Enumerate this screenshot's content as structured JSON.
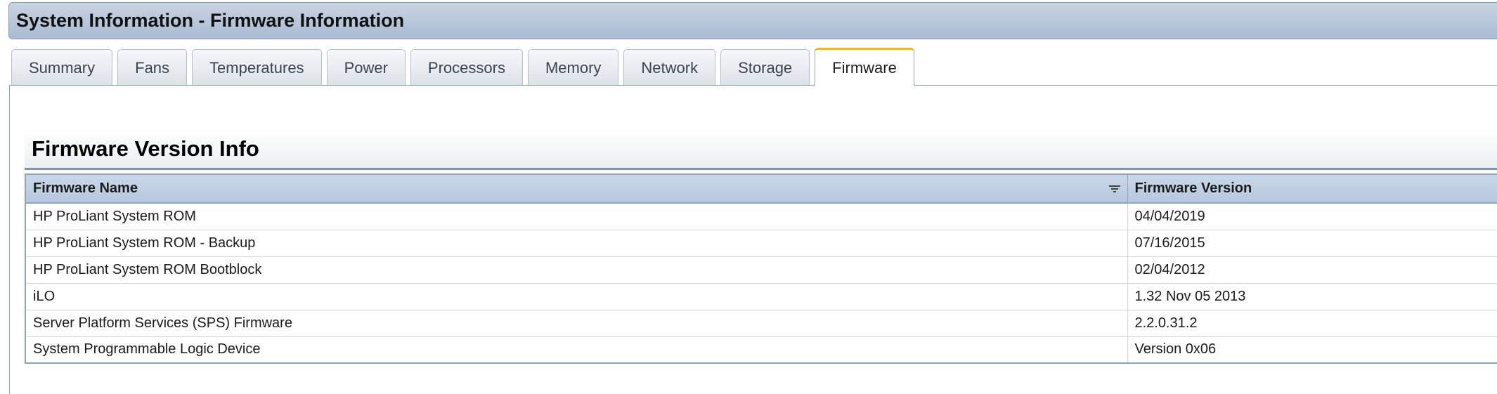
{
  "window": {
    "title": "System Information - Firmware Information"
  },
  "tabs": [
    {
      "label": "Summary",
      "active": false
    },
    {
      "label": "Fans",
      "active": false
    },
    {
      "label": "Temperatures",
      "active": false
    },
    {
      "label": "Power",
      "active": false
    },
    {
      "label": "Processors",
      "active": false
    },
    {
      "label": "Memory",
      "active": false
    },
    {
      "label": "Network",
      "active": false
    },
    {
      "label": "Storage",
      "active": false
    },
    {
      "label": "Firmware",
      "active": true
    }
  ],
  "section": {
    "title": "Firmware Version Info"
  },
  "table": {
    "columns": [
      "Firmware Name",
      "Firmware Version"
    ],
    "rows": [
      [
        "HP ProLiant System ROM",
        "04/04/2019"
      ],
      [
        "HP ProLiant System ROM - Backup",
        "07/16/2015"
      ],
      [
        "HP ProLiant System ROM Bootblock",
        "02/04/2012"
      ],
      [
        "iLO",
        "1.32 Nov 05 2013"
      ],
      [
        "Server Platform Services (SPS) Firmware",
        "2.2.0.31.2"
      ],
      [
        "System Programmable Logic Device",
        "Version 0x06"
      ]
    ]
  },
  "colors": {
    "active_tab_accent": "#f2b233",
    "header_blue": "#b6c8df",
    "border_blue": "#8fa3bc"
  },
  "icons": {
    "sort": "sort-icon"
  }
}
